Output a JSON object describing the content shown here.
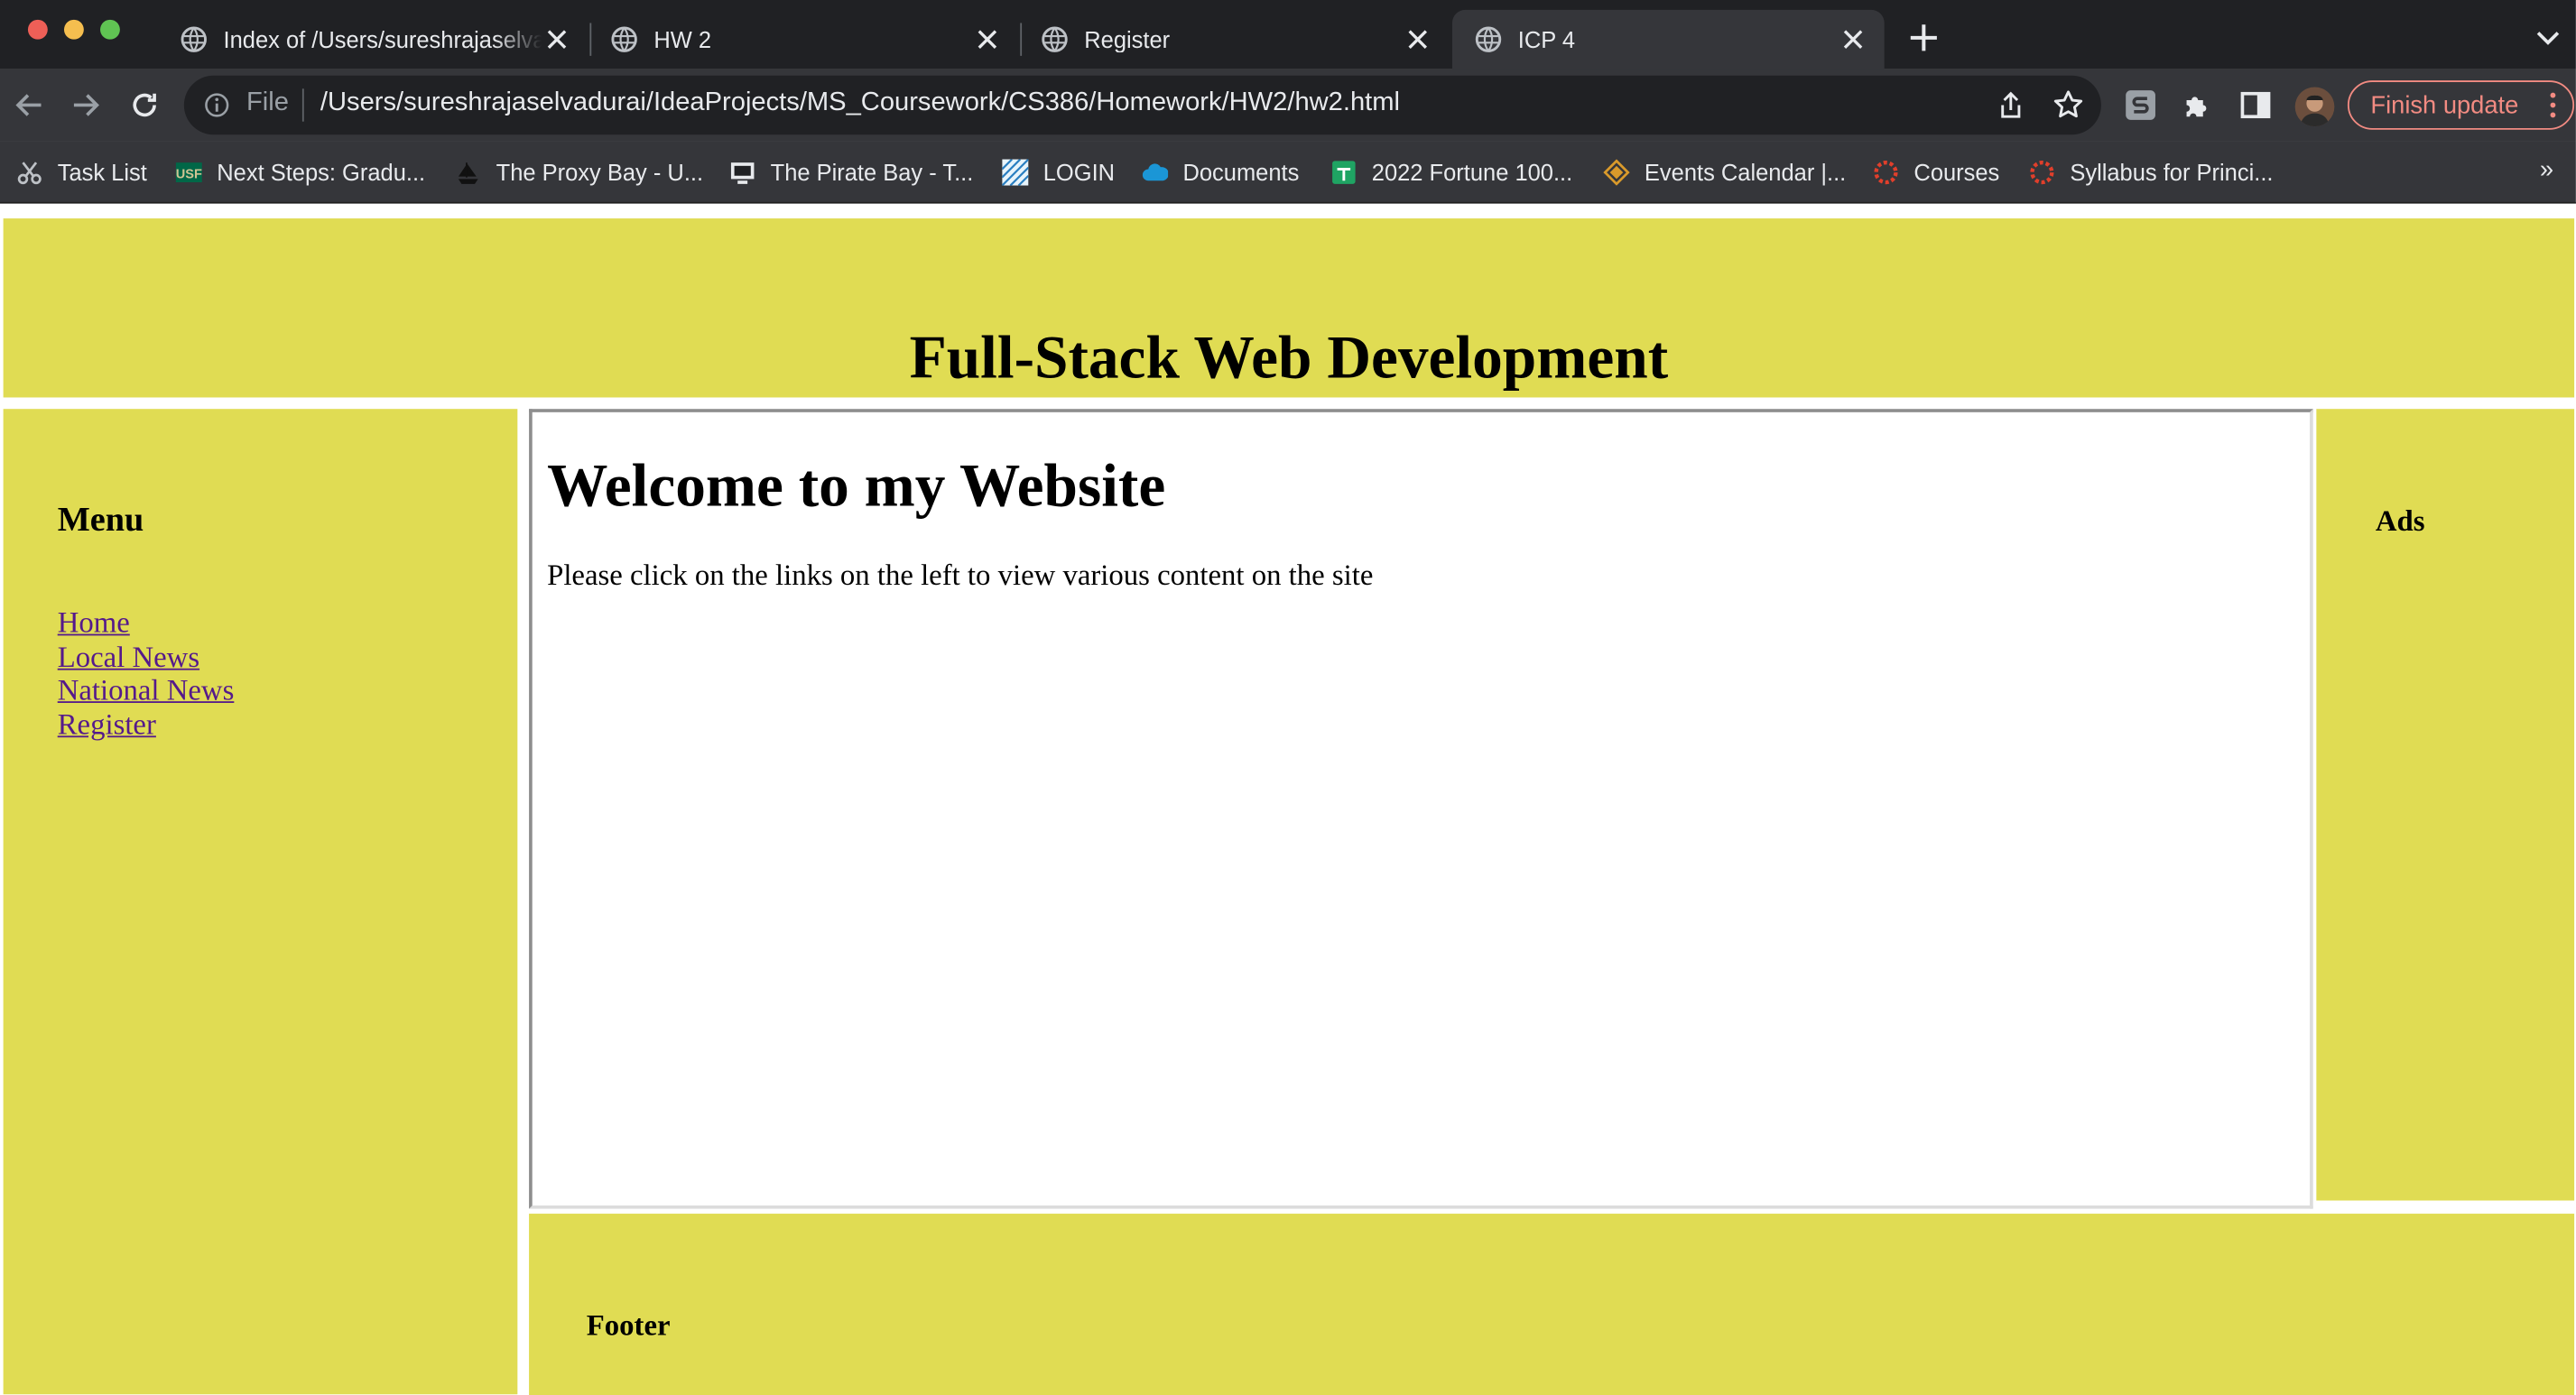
{
  "browser": {
    "tabs": [
      {
        "title": "Index of /Users/sureshrajaselvadurai/",
        "active": false
      },
      {
        "title": "HW 2",
        "active": false
      },
      {
        "title": "Register",
        "active": false
      },
      {
        "title": "ICP 4",
        "active": true
      }
    ],
    "address": {
      "scheme_label": "File",
      "url": "/Users/sureshrajaselvadurai/IdeaProjects/MS_Coursework/CS386/Homework/HW2/hw2.html"
    },
    "finish_update_label": "Finish update",
    "bookmarks": [
      {
        "label": "Task List",
        "icon": "scissors-icon"
      },
      {
        "label": "Next Steps: Gradu...",
        "icon": "usf-icon"
      },
      {
        "label": "The Proxy Bay - U...",
        "icon": "ship-icon"
      },
      {
        "label": "The Pirate Bay - T...",
        "icon": "monitor-icon"
      },
      {
        "label": "LOGIN",
        "icon": "login-icon"
      },
      {
        "label": "Documents",
        "icon": "cloud-icon"
      },
      {
        "label": "2022 Fortune 100...",
        "icon": "sheets-icon"
      },
      {
        "label": "Events Calendar |...",
        "icon": "diamond-icon"
      },
      {
        "label": "Courses",
        "icon": "canvas-icon"
      },
      {
        "label": "Syllabus for Princi...",
        "icon": "canvas-icon"
      }
    ],
    "bookmarks_overflow": "»"
  },
  "page": {
    "header_title": "Full-Stack Web Development",
    "menu": {
      "heading": "Menu",
      "links": [
        "Home",
        "Local News",
        "National News",
        "Register"
      ]
    },
    "main": {
      "heading": "Welcome to my Website",
      "text": "Please click on the links on the left to view various content on the site"
    },
    "ads_heading": "Ads",
    "footer_heading": "Footer"
  },
  "colors": {
    "panel": "#e0dc53",
    "link_visited": "#551a8b",
    "chrome_dark": "#202124",
    "chrome_toolbar": "#35363a",
    "finish_update_accent": "#f28b82"
  }
}
